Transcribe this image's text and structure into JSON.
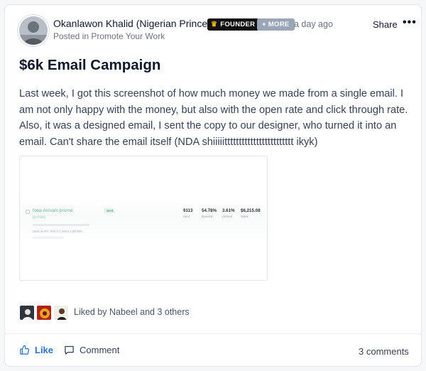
{
  "post": {
    "author": "Okanlawon Khalid (Nigerian Prince)",
    "badges": {
      "founder": "FOUNDER",
      "more": "+ MORE"
    },
    "time": "a day ago",
    "posted_in": "Posted in Promote Your Work",
    "share_label": "Share",
    "title": "$6k Email Campaign",
    "body": "Last week, I got this screenshot of how much money we made from a single email. I am not only happy with the money, but also with the open rate and click through rate. Also, it was a designed email, I sent the copy to our designer, who turned it into an email. Can't share the email itself (NDA shiiiiitttttttttttttttttttttttt ikyk)",
    "screenshot": {
      "campaign_name": "New Arrivals promo",
      "campaign_sub": "[Email]",
      "tag": "Sent",
      "sent_line": "Sent on Fri, Feb 17, 2022 1:30 PM",
      "stats": [
        {
          "value": "9113",
          "label": "Sent"
        },
        {
          "value": "54.78%",
          "label": "Opened"
        },
        {
          "value": "3.61%",
          "label": "Clicked"
        },
        {
          "value": "$6,215.08",
          "label": "Sales"
        }
      ]
    },
    "liked_by": "Liked by Nabeel and 3 others",
    "actions": {
      "like": "Like",
      "comment": "Comment"
    },
    "comments_count": "3 comments"
  },
  "colors": {
    "like_blue": "#2f6fd1",
    "founder_badge": "#111111",
    "more_badge": "#9aa6b5",
    "text_muted": "#6b7280"
  }
}
